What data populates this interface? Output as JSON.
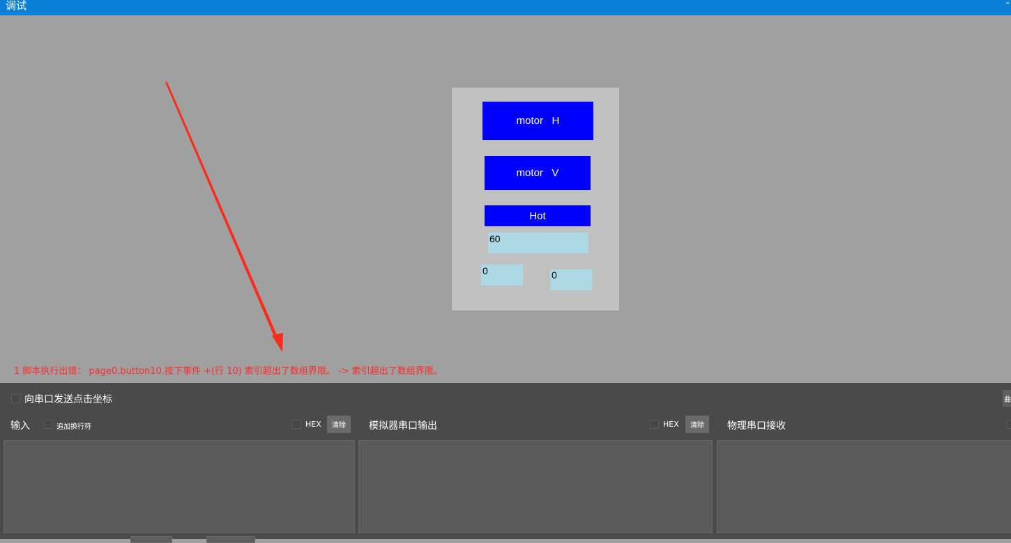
{
  "window": {
    "title": "调试",
    "minimize_label": "-"
  },
  "simulator": {
    "buttons": [
      {
        "label": "motor   H"
      },
      {
        "label": "motor   V"
      },
      {
        "label": "Hot"
      }
    ],
    "number_boxes": [
      {
        "value": "60"
      },
      {
        "value": "0"
      },
      {
        "value": "0"
      }
    ]
  },
  "error": {
    "message": "1 脚本执行出错： page0.button10.按下事件 +(行 10) 索引超出了数组界限。 -> 索引超出了数组界限。",
    "color": "#ff2a2a"
  },
  "annotation": {
    "arrow_color": "#ff2a1a"
  },
  "debug_panel": {
    "send_coords_label": "向串口发送点击坐标",
    "right_edge_button_label": "曲",
    "input_section": {
      "title": "输入",
      "append_newline_label": "追加换行符",
      "hex_label": "HEX",
      "clear_label": "清除"
    },
    "sim_output_section": {
      "title": "模拟器串口输出",
      "hex_label": "HEX",
      "clear_label": "清除"
    },
    "physical_receive_section": {
      "title": "物理串口接收"
    }
  },
  "colors": {
    "titlebar": "#0a7fd6",
    "canvas_background": "#a0a0a0",
    "panel_background": "#c0c0c0",
    "button_blue": "#0000ff",
    "number_box": "#add8e6",
    "debug_background": "#4a4a4a"
  }
}
